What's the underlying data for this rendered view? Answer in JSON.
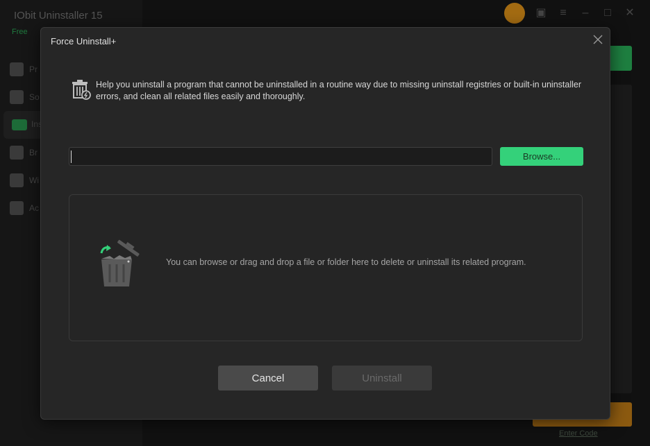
{
  "background": {
    "app_title": "IObit Uninstaller 15",
    "plan": "Free",
    "nav_items": [
      "Pr",
      "So",
      "Ins",
      "Br",
      "Wi",
      "Ac"
    ],
    "enter_code": "Enter Code"
  },
  "dialog": {
    "title": "Force Uninstall+",
    "intro": "Help you uninstall a program that cannot be uninstalled in a routine way due to missing uninstall registries or built-in uninstaller errors, and clean all related files easily and thoroughly.",
    "path_input": {
      "value": "",
      "placeholder": ""
    },
    "browse_label": "Browse...",
    "drop_text": "You can browse or drag and drop a file or folder here to delete or uninstall its related program.",
    "cancel_label": "Cancel",
    "uninstall_label": "Uninstall"
  },
  "colors": {
    "accent_green": "#34d17a",
    "dialog_bg": "#262626",
    "disabled_button": "#3a3a3a"
  },
  "icons": {
    "close": "close-icon",
    "intro": "trash-bolt-icon",
    "drop": "trash-drop-icon"
  }
}
